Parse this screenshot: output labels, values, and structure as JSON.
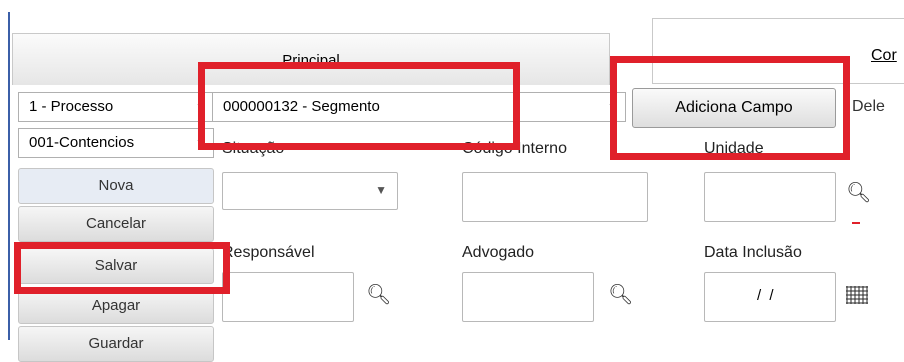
{
  "tabs": {
    "principal": "Principal",
    "second": "Cor"
  },
  "combos": {
    "processo": "1 - Processo",
    "segmento": "000000132 - Segmento",
    "contencioso": "001-Contencios"
  },
  "buttons": {
    "adiciona_campo": "Adiciona Campo",
    "delete_partial": "Dele"
  },
  "sidebar": {
    "items": [
      "Nova",
      "Cancelar",
      "Salvar",
      "Apagar",
      "Guardar"
    ]
  },
  "form": {
    "situacao": "Situação",
    "codigo_interno": "Código Interno",
    "unidade": "Unidade",
    "responsavel": "Responsável",
    "advogado": "Advogado",
    "data_inclusao": "Data Inclusão",
    "data_value": "/ /"
  },
  "colors": {
    "highlight": "#e0202a",
    "left_line": "#3b5fa8"
  }
}
